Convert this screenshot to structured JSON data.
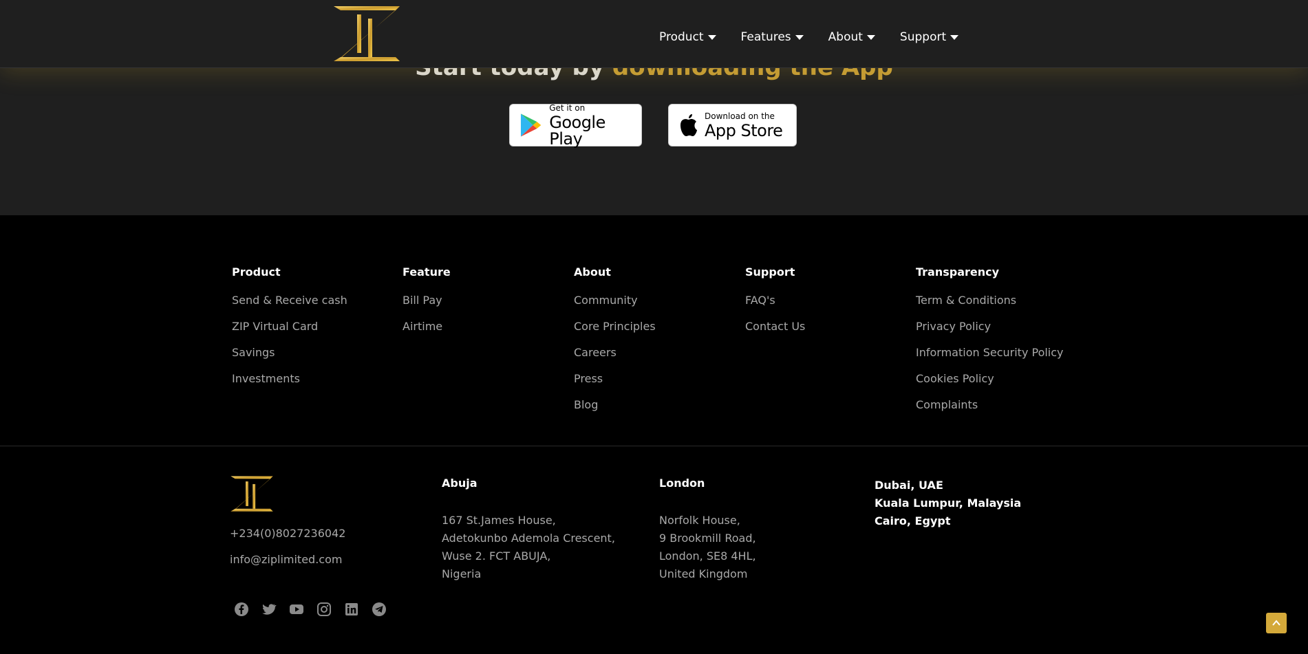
{
  "header": {
    "logo": "zip-logo",
    "nav": [
      {
        "label": "Product"
      },
      {
        "label": "Features"
      },
      {
        "label": "About"
      },
      {
        "label": "Support"
      }
    ]
  },
  "download": {
    "heading_plain": "Start today by ",
    "heading_accent": "downloading the App",
    "google": {
      "small": "Get it on",
      "big": "Google Play"
    },
    "apple": {
      "small": "Download on the",
      "big": "App Store"
    }
  },
  "footer": {
    "columns": [
      {
        "title": "Product",
        "links": [
          "Send & Receive cash",
          "ZIP Virtual Card",
          "Savings",
          "Investments"
        ]
      },
      {
        "title": "Feature",
        "links": [
          "Bill Pay",
          "Airtime"
        ]
      },
      {
        "title": "About",
        "links": [
          "Community",
          "Core Principles",
          "Careers",
          "Press",
          "Blog"
        ]
      },
      {
        "title": "Support",
        "links": [
          "FAQ's",
          "Contact Us"
        ]
      },
      {
        "title": "Transparency",
        "links": [
          "Term & Conditions",
          "Privacy Policy",
          "Information Security Policy",
          "Cookies Policy",
          "Complaints"
        ]
      }
    ],
    "phone": "+234(0)8027236042",
    "email": "info@ziplimited.com",
    "socials": [
      "facebook-icon",
      "twitter-icon",
      "youtube-icon",
      "instagram-icon",
      "linkedin-icon",
      "telegram-icon"
    ],
    "offices": [
      {
        "city": "Abuja",
        "lines": [
          "167 St.James House,",
          "Adetokunbo Ademola Crescent,",
          "Wuse 2. FCT ABUJA,",
          "Nigeria"
        ]
      },
      {
        "city": "London",
        "lines": [
          "Norfolk House,",
          "9 Brookmill Road,",
          "London, SE8 4HL,",
          "United Kingdom"
        ]
      }
    ],
    "other_cities": [
      "Dubai, UAE",
      "Kuala Lumpur, Malaysia",
      "Cairo, Egypt"
    ]
  },
  "colors": {
    "accent": "#e2b23a",
    "background": "#000000",
    "header": "#1f1f1f",
    "muted_text": "#a9a9a9"
  }
}
